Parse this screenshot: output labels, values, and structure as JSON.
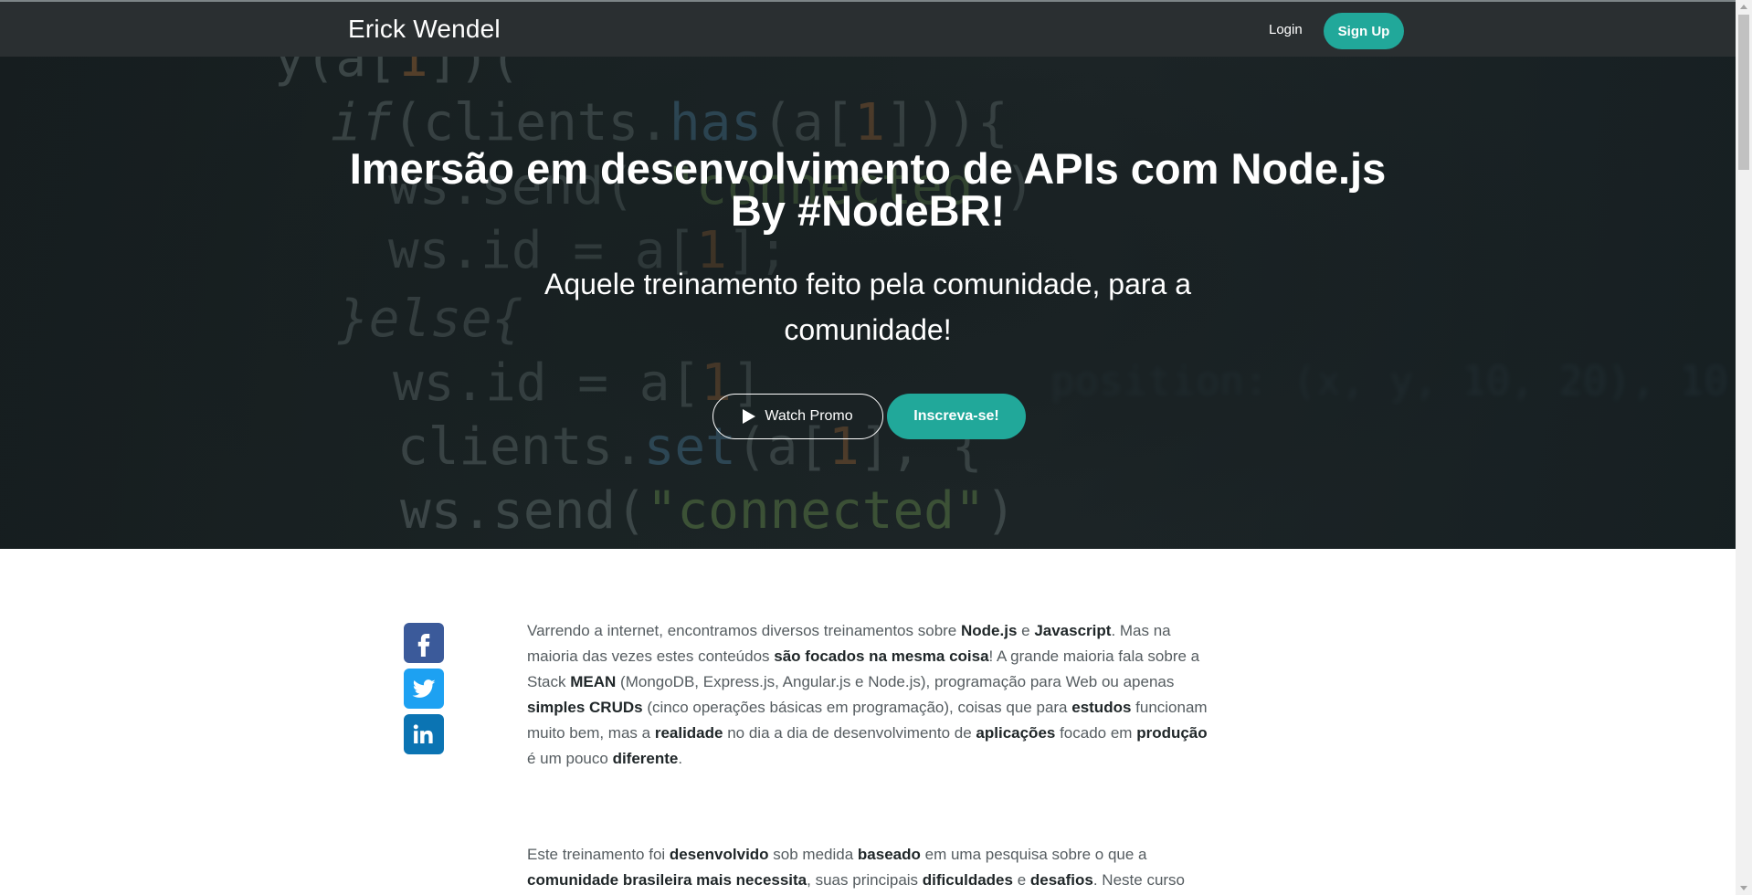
{
  "navbar": {
    "brand": "Erick Wendel",
    "login": "Login",
    "signup": "Sign Up"
  },
  "hero": {
    "title_line1": "Imersão em desenvolvimento de APIs com Node.js",
    "title_line2": "By #NodeBR!",
    "subtitle": "Aquele treinamento feito pela comunidade, para a comunidade!",
    "watch_promo": "Watch Promo",
    "subscribe": "Inscreva-se!"
  },
  "social": {
    "icons": [
      "facebook-icon",
      "twitter-icon",
      "linkedin-icon"
    ]
  },
  "content": {
    "p1": [
      {
        "t": "Varrendo a internet, encontramos diversos treinamentos sobre ",
        "b": false
      },
      {
        "t": "Node.js",
        "b": true
      },
      {
        "t": " e ",
        "b": false
      },
      {
        "t": "Javascript",
        "b": true
      },
      {
        "t": ". Mas na maioria das vezes estes conteúdos ",
        "b": false
      },
      {
        "t": "são focados na mesma coisa",
        "b": true
      },
      {
        "t": "! A grande maioria fala sobre a Stack ",
        "b": false
      },
      {
        "t": "MEAN",
        "b": true
      },
      {
        "t": " (MongoDB, Express.js, Angular.js e Node.js), programação para Web ou apenas ",
        "b": false
      },
      {
        "t": "simples CRUDs",
        "b": true
      },
      {
        "t": " (cinco operações básicas em programação), coisas que para ",
        "b": false
      },
      {
        "t": "estudos",
        "b": true
      },
      {
        "t": " funcionam muito bem, mas a ",
        "b": false
      },
      {
        "t": "realidade",
        "b": true
      },
      {
        "t": " no dia a dia de desenvolvimento de ",
        "b": false
      },
      {
        "t": "aplicações",
        "b": true
      },
      {
        "t": " focado em ",
        "b": false
      },
      {
        "t": "produção",
        "b": true
      },
      {
        "t": " é um pouco ",
        "b": false
      },
      {
        "t": "diferente",
        "b": true
      },
      {
        "t": ".",
        "b": false
      }
    ],
    "p2": [
      {
        "t": "Este treinamento foi ",
        "b": false
      },
      {
        "t": "desenvolvido",
        "b": true
      },
      {
        "t": " sob medida ",
        "b": false
      },
      {
        "t": "baseado",
        "b": true
      },
      {
        "t": " em uma pesquisa sobre o que a ",
        "b": false
      },
      {
        "t": "comunidade brasileira mais necessita",
        "b": true
      },
      {
        "t": ", suas principais ",
        "b": false
      },
      {
        "t": "dificuldades",
        "b": true
      },
      {
        "t": " e ",
        "b": false
      },
      {
        "t": "desafios",
        "b": true
      },
      {
        "t": ". Neste curso",
        "b": false
      }
    ]
  },
  "colors": {
    "accent": "#21a89a",
    "navbar": "#2a2f31",
    "facebook": "#3b5a9a",
    "twitter": "#1da1f2",
    "linkedin": "#0b74b3"
  }
}
